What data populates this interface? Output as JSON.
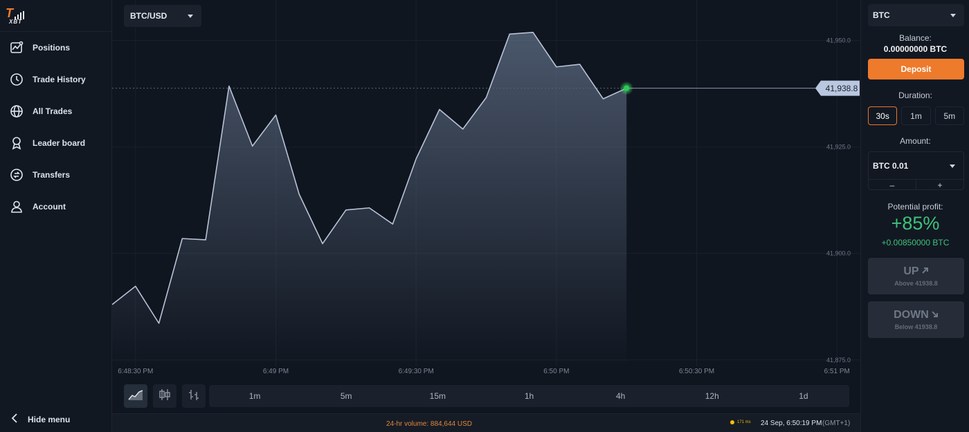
{
  "logo": {
    "brand": "XBT"
  },
  "sidebar": {
    "items": [
      {
        "label": "Positions",
        "icon": "positions-chart-icon"
      },
      {
        "label": "Trade History",
        "icon": "clock-icon"
      },
      {
        "label": "All Trades",
        "icon": "globe-icon"
      },
      {
        "label": "Leader board",
        "icon": "ribbon-icon"
      },
      {
        "label": "Transfers",
        "icon": "transfer-icon"
      },
      {
        "label": "Account",
        "icon": "user-icon"
      }
    ],
    "hide_menu": "Hide menu"
  },
  "pair": {
    "selected": "BTC/USD"
  },
  "chart_data": {
    "type": "line",
    "x": [
      "6:48:25 PM",
      "6:48:30 PM",
      "6:48:35 PM",
      "6:48:40 PM",
      "6:48:45 PM",
      "6:48:50 PM",
      "6:48:55 PM",
      "6:49:00 PM",
      "6:49:05 PM",
      "6:49:10 PM",
      "6:49:15 PM",
      "6:49:20 PM",
      "6:49:25 PM",
      "6:49:30 PM",
      "6:49:35 PM",
      "6:49:40 PM",
      "6:49:45 PM",
      "6:49:50 PM",
      "6:49:55 PM",
      "6:50:00 PM",
      "6:50:05 PM",
      "6:50:10 PM",
      "6:50:15 PM"
    ],
    "values": [
      41888.0,
      41892.3,
      41883.6,
      41903.5,
      41903.2,
      41939.3,
      41925.2,
      41932.5,
      41913.9,
      41902.3,
      41910.2,
      41910.7,
      41906.9,
      41922.2,
      41933.8,
      41929.2,
      41936.6,
      41951.5,
      41951.9,
      41943.8,
      41944.4,
      41936.3,
      41938.8
    ],
    "current_price": "41,938.8",
    "current_price_value": 41938.8,
    "y_ticks": [
      "41,950.0",
      "41,925.0",
      "41,900.0",
      "41,875.0"
    ],
    "y_tick_values": [
      41950,
      41925,
      41900,
      41875
    ],
    "x_ticks": [
      "6:48:30 PM",
      "6:49 PM",
      "6:49:30 PM",
      "6:50 PM",
      "6:50:30 PM",
      "6:51 PM"
    ],
    "ylim": [
      41873.5,
      41959.5
    ],
    "xlim": [
      "6:48:25 PM",
      "6:51:05 PM"
    ],
    "grid": true,
    "line_color": "#b8c3d6",
    "marker_color": "#2ecc55"
  },
  "chart_types": [
    "line-chart-icon",
    "candlestick-icon",
    "bar-chart-icon"
  ],
  "timeframes": [
    "1m",
    "5m",
    "15m",
    "1h",
    "4h",
    "12h",
    "1d"
  ],
  "status": {
    "volume": "24-hr volume: 884,644 USD",
    "ping": "171 ms",
    "datetime": "24 Sep, 6:50:19 PM",
    "timezone": "(GMT+1)"
  },
  "panel": {
    "asset": "BTC",
    "balance_label": "Balance:",
    "balance_value": "0.00000000 BTC",
    "deposit_label": "Deposit",
    "duration_label": "Duration:",
    "durations": [
      "30s",
      "1m",
      "5m"
    ],
    "selected_duration": "30s",
    "amount_label": "Amount:",
    "amount_value": "BTC 0.01",
    "minus": "–",
    "plus": "+",
    "profit_label": "Potential profit:",
    "profit_pct": "+85%",
    "profit_btc": "+0.00850000 BTC",
    "up_label": "UP",
    "up_sub": "Above 41938.8",
    "down_label": "DOWN",
    "down_sub": "Below 41938.8"
  },
  "colors": {
    "accent": "#ee7a2c",
    "profit": "#3fc27a",
    "background": "#101620"
  }
}
